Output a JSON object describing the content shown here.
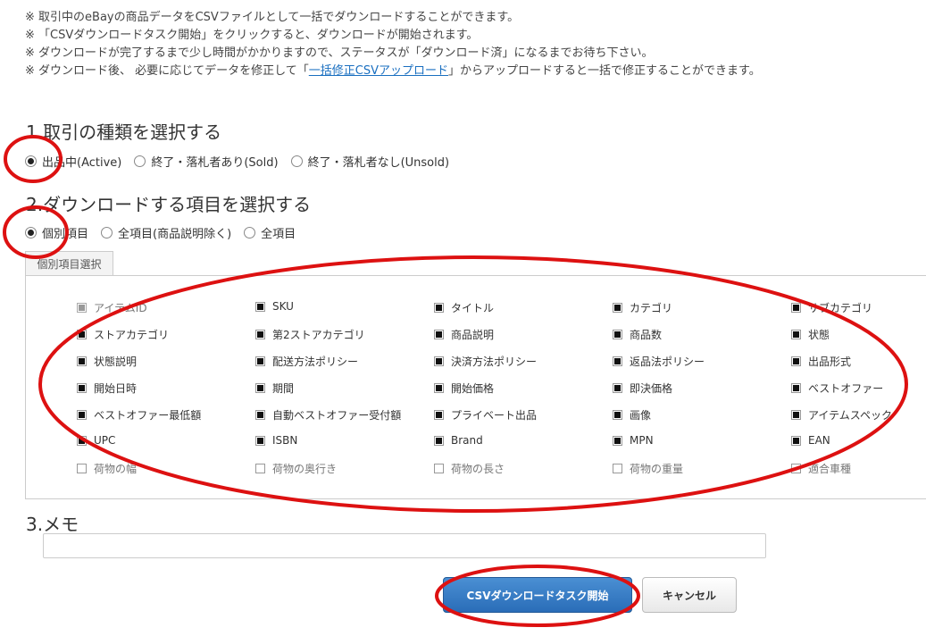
{
  "notes": {
    "line1": "※ 取引中のeBayの商品データをCSVファイルとして一括でダウンロードすることができます。",
    "line2": "※ 「CSVダウンロードタスク開始」をクリックすると、ダウンロードが開始されます。",
    "line3": "※ ダウンロードが完了するまで少し時間がかかりますので、ステータスが「ダウンロード済」になるまでお待ち下さい。",
    "line4_before": "※ ダウンロード後、 必要に応じてデータを修正して「",
    "line4_link": "一括修正CSVアップロード",
    "line4_after": "」からアップロードすると一括で修正することができます。"
  },
  "section1": {
    "title": "1.取引の種類を選択する",
    "options": [
      "出品中(Active)",
      "終了・落札者あり(Sold)",
      "終了・落札者なし(Unsold)"
    ],
    "selected": 0
  },
  "section2": {
    "title": "2.ダウンロードする項目を選択する",
    "options": [
      "個別項目",
      "全項目(商品説明除く)",
      "全項目"
    ],
    "selected": 0,
    "tab_label": "個別項目選択",
    "items": [
      {
        "label": "アイテムID",
        "checked": true,
        "disabled": true
      },
      {
        "label": "SKU",
        "checked": true
      },
      {
        "label": "タイトル",
        "checked": true
      },
      {
        "label": "カテゴリ",
        "checked": true
      },
      {
        "label": "サブカテゴリ",
        "checked": true
      },
      {
        "label": "ストアカテゴリ",
        "checked": true
      },
      {
        "label": "第2ストアカテゴリ",
        "checked": true
      },
      {
        "label": "商品説明",
        "checked": true
      },
      {
        "label": "商品数",
        "checked": true
      },
      {
        "label": "状態",
        "checked": true
      },
      {
        "label": "状態説明",
        "checked": true
      },
      {
        "label": "配送方法ポリシー",
        "checked": true
      },
      {
        "label": "決済方法ポリシー",
        "checked": true
      },
      {
        "label": "返品法ポリシー",
        "checked": true
      },
      {
        "label": "出品形式",
        "checked": true
      },
      {
        "label": "開始日時",
        "checked": true
      },
      {
        "label": "期間",
        "checked": true
      },
      {
        "label": "開始価格",
        "checked": true
      },
      {
        "label": "即決価格",
        "checked": true
      },
      {
        "label": "ベストオファー",
        "checked": true
      },
      {
        "label": "ベストオファー最低額",
        "checked": true
      },
      {
        "label": "自動ベストオファー受付額",
        "checked": true
      },
      {
        "label": "プライベート出品",
        "checked": true
      },
      {
        "label": "画像",
        "checked": true
      },
      {
        "label": "アイテムスペック",
        "checked": true
      },
      {
        "label": "UPC",
        "checked": true
      },
      {
        "label": "ISBN",
        "checked": true
      },
      {
        "label": "Brand",
        "checked": true
      },
      {
        "label": "MPN",
        "checked": true
      },
      {
        "label": "EAN",
        "checked": true
      },
      {
        "label": "荷物の幅",
        "checked": false
      },
      {
        "label": "荷物の奥行き",
        "checked": false
      },
      {
        "label": "荷物の長さ",
        "checked": false
      },
      {
        "label": "荷物の重量",
        "checked": false
      },
      {
        "label": "適合車種",
        "checked": false
      }
    ]
  },
  "section3": {
    "title": "3.メモ",
    "memo_value": ""
  },
  "buttons": {
    "start": "CSVダウンロードタスク開始",
    "cancel": "キャンセル"
  },
  "colors": {
    "annotation": "#dd1111",
    "link": "#1a6fc0",
    "primary": "#2a6db8"
  }
}
